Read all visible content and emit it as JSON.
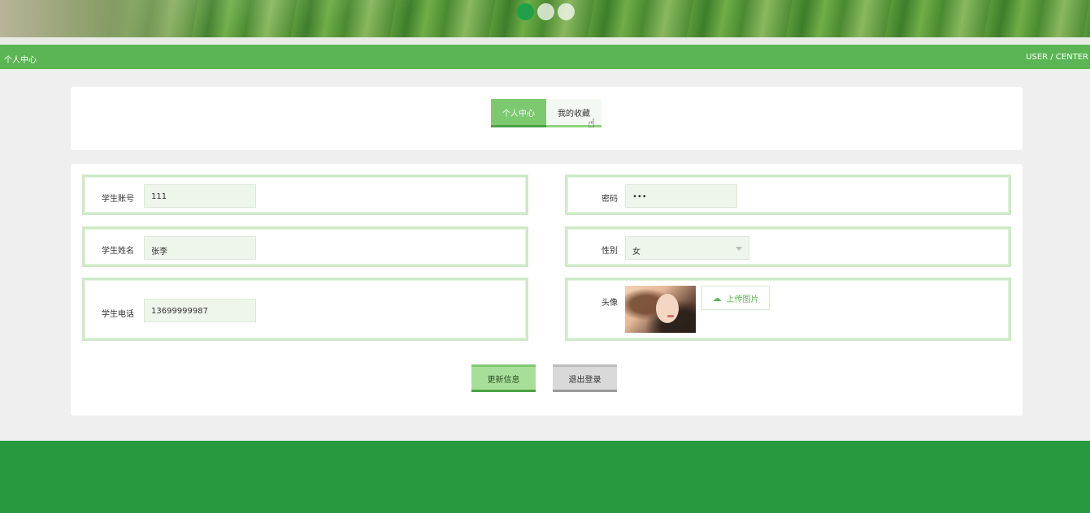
{
  "banner": {
    "slides": [
      {
        "active": true
      },
      {
        "active": false
      },
      {
        "active": false
      }
    ]
  },
  "titlebar": {
    "left": "个人中心",
    "right": "USER / CENTER"
  },
  "tabs": [
    {
      "label": "个人中心",
      "active": true
    },
    {
      "label": "我的收藏",
      "active": false
    }
  ],
  "form": {
    "account": {
      "label": "学生账号",
      "value": "111"
    },
    "password": {
      "label": "密码",
      "value": "•••"
    },
    "name": {
      "label": "学生姓名",
      "value": "张李"
    },
    "gender": {
      "label": "性别",
      "value": "女"
    },
    "phone": {
      "label": "学生电话",
      "value": "13699999987"
    },
    "avatar": {
      "label": "头像",
      "upload_label": "上传图片"
    }
  },
  "actions": {
    "update_label": "更新信息",
    "logout_label": "退出登录"
  },
  "colors": {
    "primary": "#5cb555",
    "footer": "#27993f",
    "active_dot": "#21a049"
  }
}
